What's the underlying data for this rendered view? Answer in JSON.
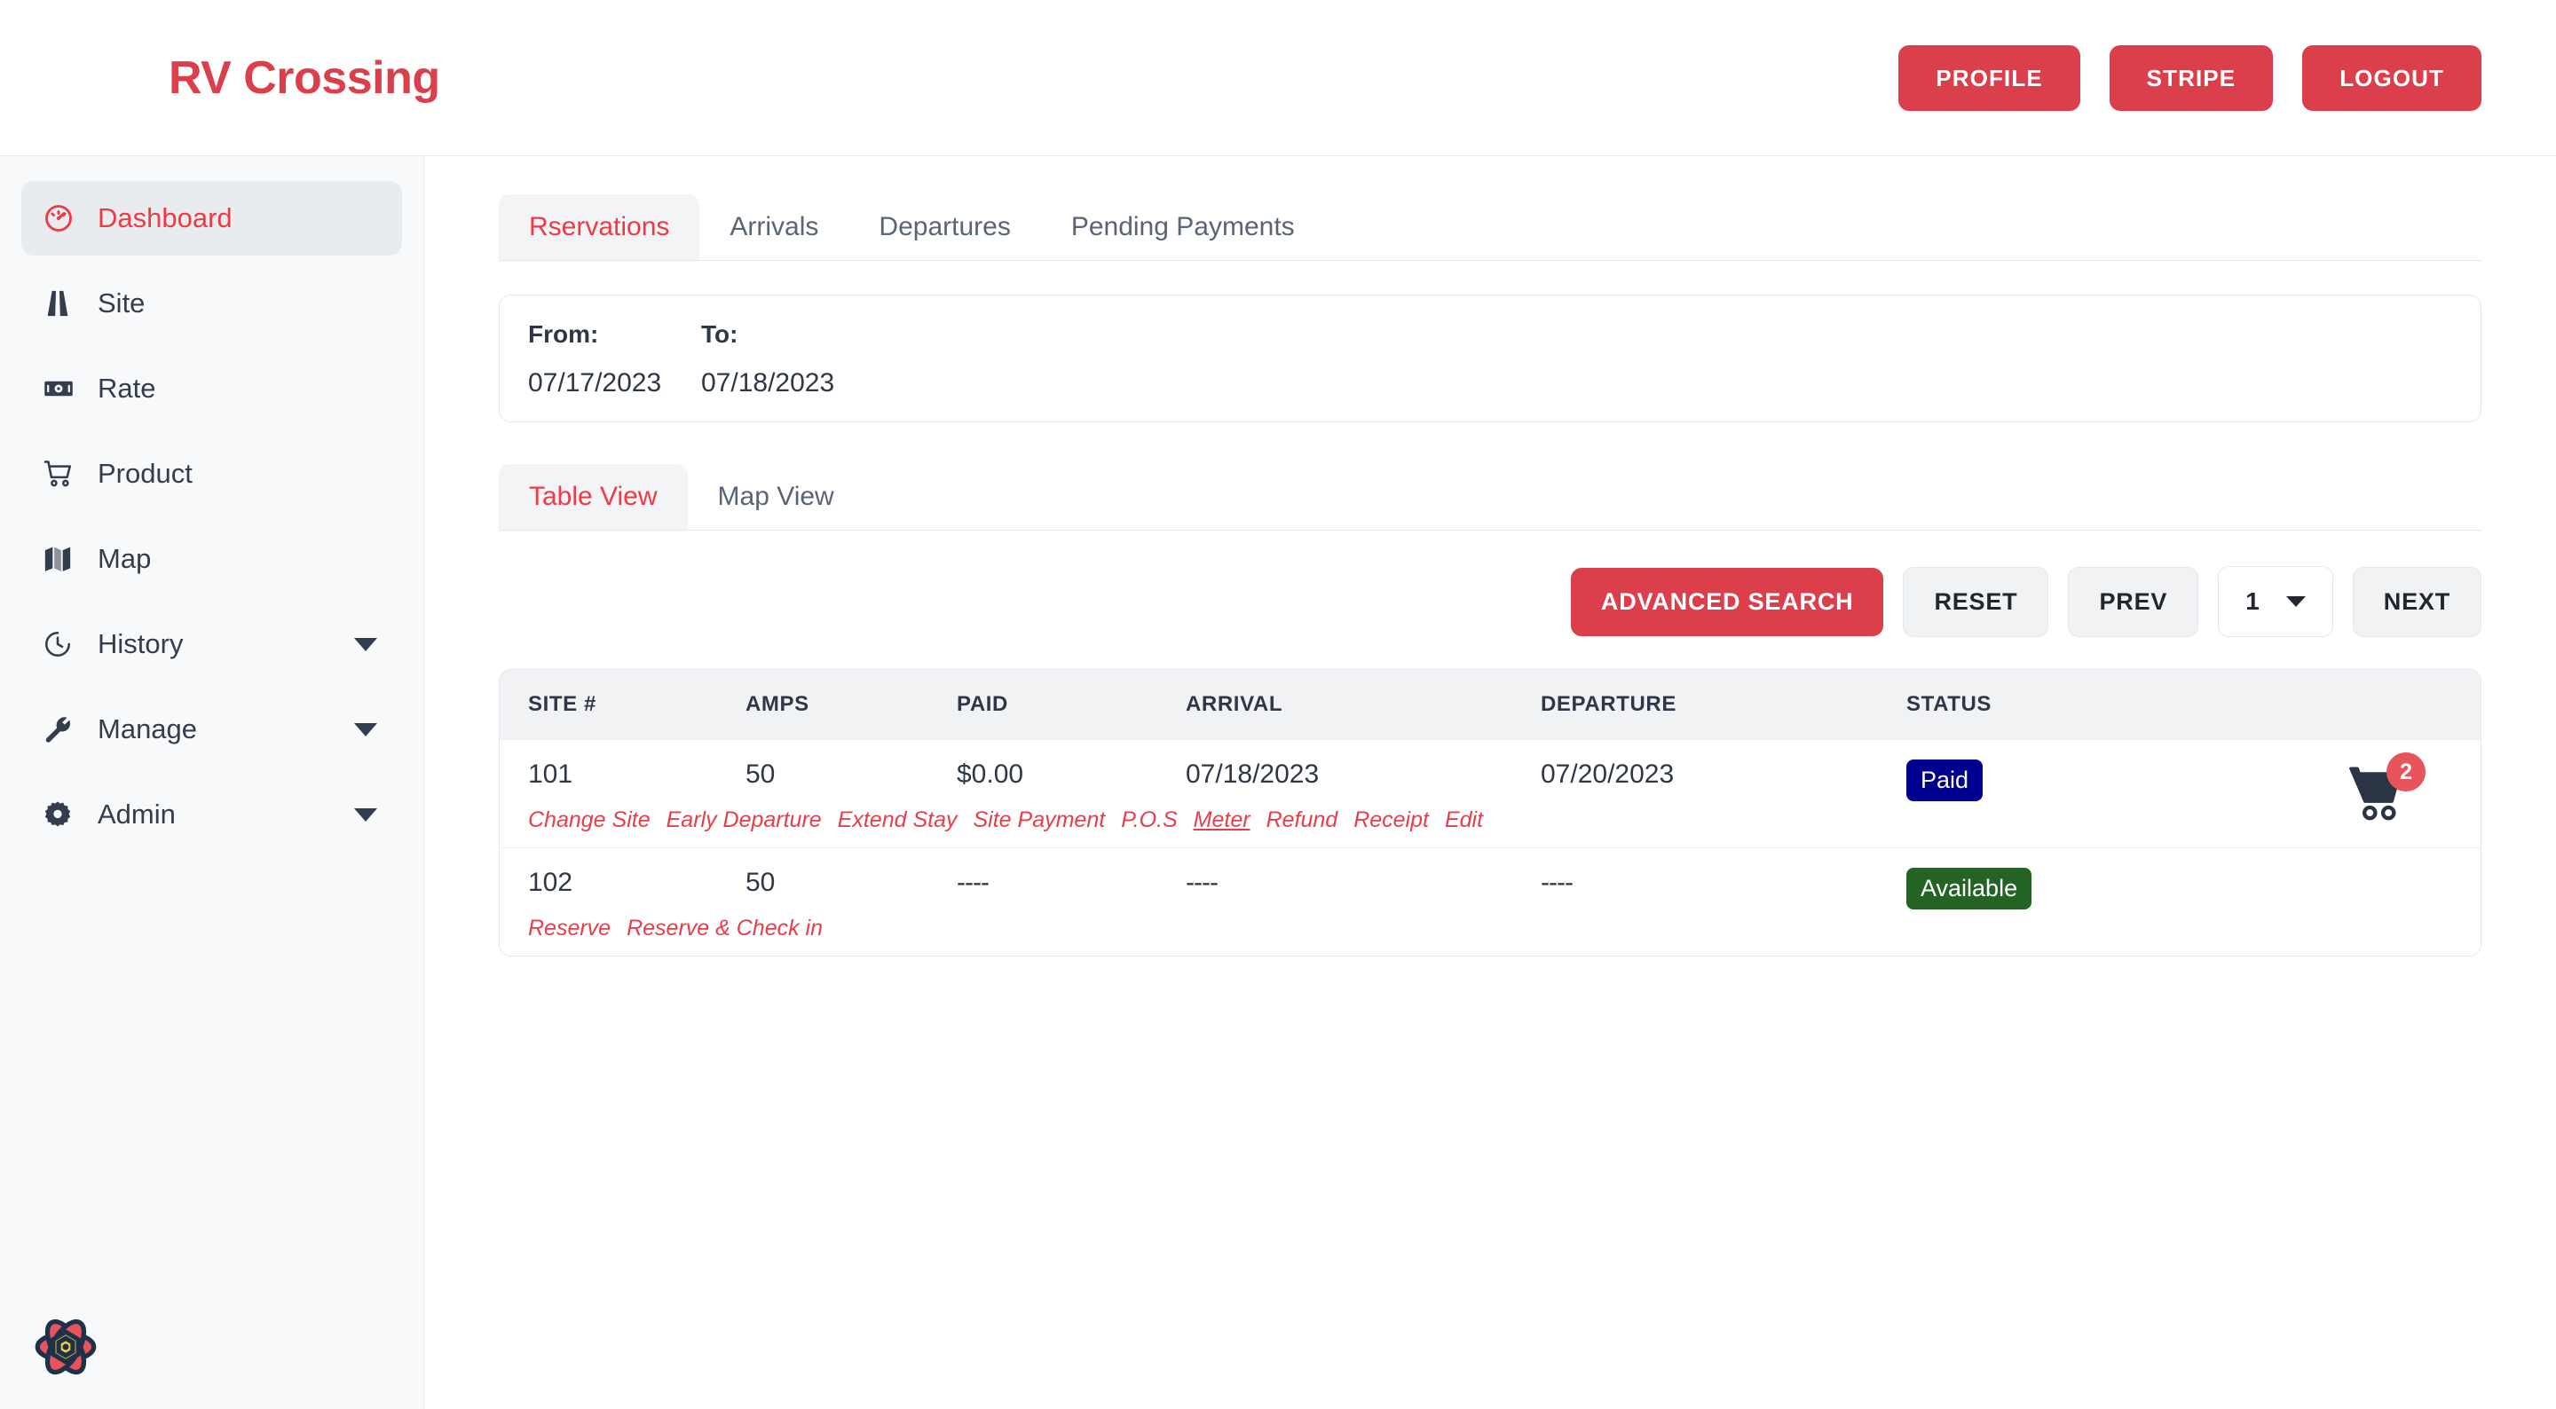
{
  "header": {
    "brand": "RV Crossing",
    "buttons": [
      {
        "label": "PROFILE",
        "name": "profile-button"
      },
      {
        "label": "STRIPE",
        "name": "stripe-button"
      },
      {
        "label": "LOGOUT",
        "name": "logout-button"
      }
    ]
  },
  "sidebar": {
    "items": [
      {
        "label": "Dashboard",
        "icon": "gauge-icon",
        "active": true,
        "caret": false
      },
      {
        "label": "Site",
        "icon": "road-icon",
        "active": false,
        "caret": false
      },
      {
        "label": "Rate",
        "icon": "money-bill-icon",
        "active": false,
        "caret": false
      },
      {
        "label": "Product",
        "icon": "shopping-cart-icon",
        "active": false,
        "caret": false
      },
      {
        "label": "Map",
        "icon": "map-icon",
        "active": false,
        "caret": false
      },
      {
        "label": "History",
        "icon": "clock-icon",
        "active": false,
        "caret": true
      },
      {
        "label": "Manage",
        "icon": "wrench-icon",
        "active": false,
        "caret": true
      },
      {
        "label": "Admin",
        "icon": "gear-icon",
        "active": false,
        "caret": true
      }
    ],
    "footer_logo": "flower-logo"
  },
  "main": {
    "tabs": [
      {
        "label": "Rservations",
        "active": true
      },
      {
        "label": "Arrivals",
        "active": false
      },
      {
        "label": "Departures",
        "active": false
      },
      {
        "label": "Pending Payments",
        "active": false
      }
    ],
    "date_filter": {
      "from_label": "From:",
      "from_value": "07/17/2023",
      "to_label": "To:",
      "to_value": "07/18/2023"
    },
    "view_tabs": [
      {
        "label": "Table View",
        "active": true
      },
      {
        "label": "Map View",
        "active": false
      }
    ],
    "toolbar": {
      "advanced_search": "ADVANCED SEARCH",
      "reset": "RESET",
      "prev": "PREV",
      "page": "1",
      "next": "NEXT"
    },
    "table": {
      "columns": [
        "SITE #",
        "AMPS",
        "PAID",
        "ARRIVAL",
        "DEPARTURE",
        "STATUS"
      ],
      "rows": [
        {
          "site": "101",
          "amps": "50",
          "paid": "$0.00",
          "arrival": "07/18/2023",
          "departure": "07/20/2023",
          "status": "Paid",
          "status_color": "#00008f",
          "cart_count": "2",
          "actions": [
            {
              "label": "Change Site",
              "hovered": false
            },
            {
              "label": "Early Departure",
              "hovered": false
            },
            {
              "label": "Extend Stay",
              "hovered": false
            },
            {
              "label": "Site Payment",
              "hovered": false
            },
            {
              "label": "P.O.S",
              "hovered": false
            },
            {
              "label": "Meter",
              "hovered": true
            },
            {
              "label": "Refund",
              "hovered": false
            },
            {
              "label": "Receipt",
              "hovered": false
            },
            {
              "label": "Edit",
              "hovered": false
            }
          ]
        },
        {
          "site": "102",
          "amps": "50",
          "paid": "----",
          "arrival": "----",
          "departure": "----",
          "status": "Available",
          "status_color": "#256325",
          "cart_count": null,
          "actions": [
            {
              "label": "Reserve",
              "hovered": false
            },
            {
              "label": "Reserve & Check in",
              "hovered": false
            }
          ]
        }
      ]
    }
  },
  "colors": {
    "brand_red": "#dc3f4c",
    "link_red": "#e83e4a",
    "text_dark": "#2f3747",
    "paid_navy": "#00008f",
    "available_green": "#256325",
    "sidebar_bg": "#f8f9fb"
  }
}
